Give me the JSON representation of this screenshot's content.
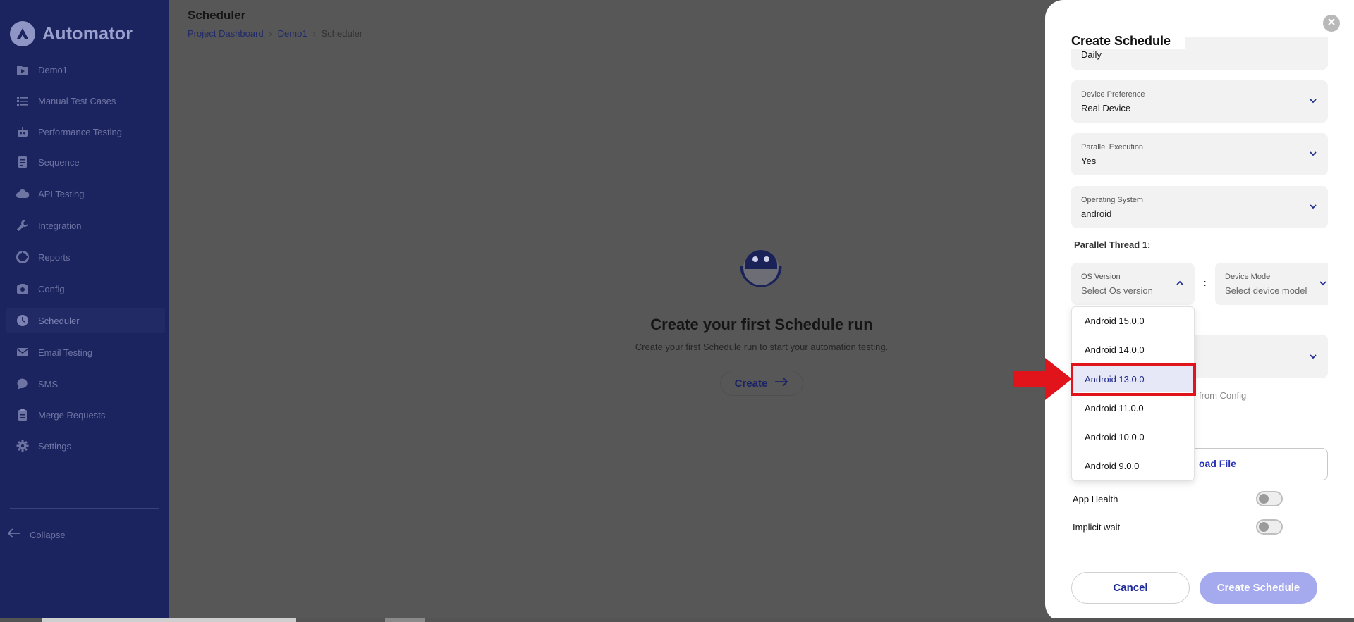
{
  "sidebar": {
    "brand": "Automator",
    "items": [
      {
        "label": "Demo1",
        "icon": "folder-play-icon"
      },
      {
        "label": "Manual Test Cases",
        "icon": "list-icon"
      },
      {
        "label": "Performance Testing",
        "icon": "robot-icon"
      },
      {
        "label": "Sequence",
        "icon": "document-icon"
      },
      {
        "label": "API Testing",
        "icon": "cloud-icon"
      },
      {
        "label": "Integration",
        "icon": "wrench-icon"
      },
      {
        "label": "Reports",
        "icon": "pie-chart-icon"
      },
      {
        "label": "Config",
        "icon": "camera-icon"
      },
      {
        "label": "Scheduler",
        "icon": "clock-icon"
      },
      {
        "label": "Email Testing",
        "icon": "mail-icon"
      },
      {
        "label": "SMS",
        "icon": "chat-icon"
      },
      {
        "label": "Merge Requests",
        "icon": "clipboard-icon"
      },
      {
        "label": "Settings",
        "icon": "gear-icon"
      }
    ],
    "active_index": 8,
    "collapse_label": "Collapse"
  },
  "header": {
    "title": "Scheduler",
    "breadcrumb": [
      "Project Dashboard",
      "Demo1",
      "Scheduler"
    ]
  },
  "empty_state": {
    "title": "Create your first Schedule run",
    "subtitle": "Create your first Schedule run to start your automation testing.",
    "button_label": "Create"
  },
  "drawer": {
    "title": "Create Schedule",
    "frequency_value": "Daily",
    "fields": [
      {
        "label": "Device Preference",
        "value": "Real Device"
      },
      {
        "label": "Parallel Execution",
        "value": "Yes"
      },
      {
        "label": "Operating System",
        "value": "android"
      }
    ],
    "thread_label": "Parallel Thread 1:",
    "os_version": {
      "label": "OS Version",
      "placeholder": "Select Os version"
    },
    "device_model": {
      "label": "Device Model",
      "placeholder": "Select device model"
    },
    "separator": ":",
    "os_options": [
      "Android 15.0.0",
      "Android 14.0.0",
      "Android 13.0.0",
      "Android 11.0.0",
      "Android 10.0.0",
      "Android 9.0.0"
    ],
    "selected_os_index": 2,
    "from_config_text": "from Config",
    "upload_text": "oad File",
    "toggles": [
      {
        "label": "App Health",
        "on": false
      },
      {
        "label": "Implicit wait",
        "on": false
      }
    ],
    "cancel_label": "Cancel",
    "create_label": "Create Schedule"
  },
  "colors": {
    "sidebar_bg": "#1c2460",
    "overlay": "#575757",
    "accent": "#2632b8",
    "highlight_red": "#e1131b",
    "create_button": "#a5a9ee"
  }
}
